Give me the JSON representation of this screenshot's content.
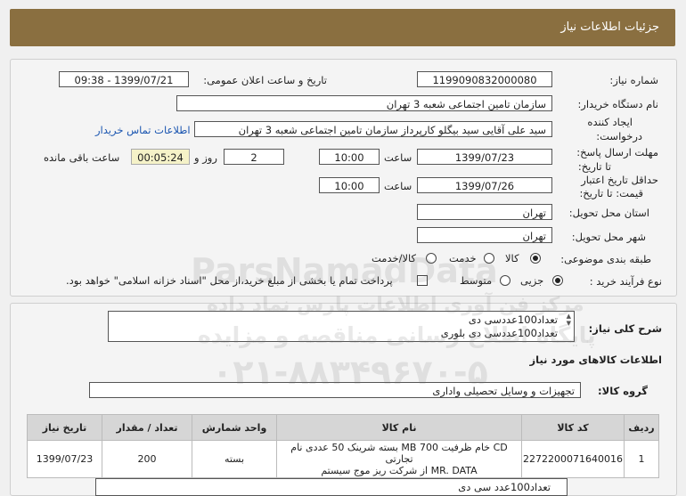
{
  "page_title": "جزئیات اطلاعات نیاز",
  "need_number_label": "شماره نیاز:",
  "need_number": "1199090832000080",
  "announce_label": "تاریخ و ساعت اعلان عمومی:",
  "announce_value": "1399/07/21 - 09:38",
  "buyer_label": "نام دستگاه خریدار:",
  "buyer_value": "سازمان تامین اجتماعی شعبه 3 تهران",
  "creator_label_1": "ایجاد کننده",
  "creator_label_2": "درخواست:",
  "creator_value": "سید علی آقایی سید بیگلو کارپرداز سازمان تامین اجتماعی شعبه 3 تهران",
  "contact_link": "اطلاعات تماس خریدار",
  "reply_label_1": "مهلت ارسال پاسخ:",
  "reply_label_2": "تا تاریخ:",
  "reply_date": "1399/07/23",
  "time_label": "ساعت",
  "reply_time": "10:00",
  "days_value": "2",
  "days_label": "روز و",
  "remaining_value": "00:05:24",
  "remaining_label": "ساعت باقی مانده",
  "validity_label_1": "حداقل تاریخ اعتبار",
  "validity_label_2": "قیمت: تا تاریخ:",
  "validity_date": "1399/07/26",
  "validity_time": "10:00",
  "province_label": "استان محل تحویل:",
  "province_value": "تهران",
  "city_label": "شهر محل تحویل:",
  "city_value": "تهران",
  "category_label": "طبقه بندی موضوعی:",
  "category_options": [
    "کالا",
    "خدمت",
    "کالا/خدمت"
  ],
  "category_selected": "کالا",
  "process_label": "نوع فرآیند خرید :",
  "process_options": [
    "جزیی",
    "متوسط"
  ],
  "process_selected": "جزیی",
  "payment_note": "پرداخت تمام یا بخشی از مبلغ خرید،از محل \"اسناد خزانه اسلامی\" خواهد بود.",
  "desc_label": "شرح کلی نیاز:",
  "desc_lines": [
    "تعداد100عددسی دی",
    "تعداد100عددسی دی بلوری"
  ],
  "goods_info_title": "اطلاعات کالاهای مورد نیاز",
  "goods_group_label": "گروه کالا:",
  "goods_group_value": "تجهیزات و وسایل تحصیلی واداری",
  "table_headers": [
    "ردیف",
    "کد کالا",
    "نام کالا",
    "واحد شمارش",
    "تعداد / مقدار",
    "تاریخ نیاز"
  ],
  "table_rows": [
    {
      "row": "1",
      "code": "2272200071640016",
      "name_line1": "CD خام ظرفیت MB 700 بسته شرینک 50 عددی نام تجارتی",
      "name_line2": "MR. DATA از شرکت ریز موج سیستم",
      "unit": "بسته",
      "qty": "200",
      "date": "1399/07/23"
    }
  ],
  "bottom_partial": "تعداد100عدد سی دی",
  "watermark_brand": "ParsNamadData",
  "watermark_line1": "مرکز فن آوری اطلاعات پارس نماد داده",
  "watermark_line2": "پایگاه اطلاع رسانی مناقصه و مزایده",
  "watermark_phone": "۰۲۱-۸۸۳۴۹۶۷۰-۵"
}
